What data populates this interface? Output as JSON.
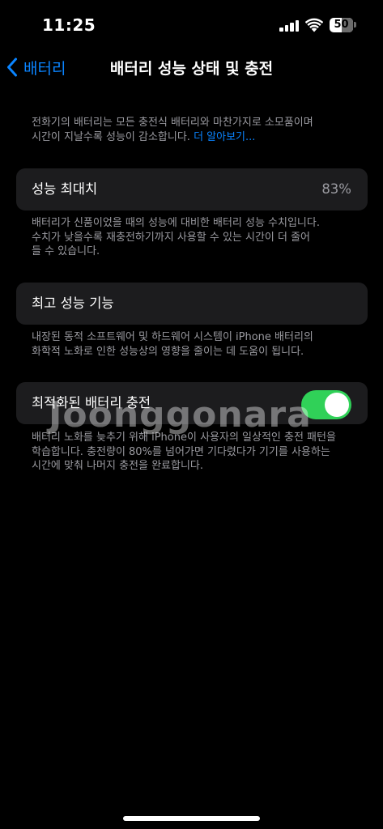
{
  "status_bar": {
    "time": "11:25",
    "battery_level": "50",
    "battery_fraction": 0.5,
    "signal_bars": 4
  },
  "nav": {
    "back_label": "배터리",
    "title": "배터리 성능 상태 및 충전"
  },
  "intro": {
    "line1": "전화기의 배터리는 모든 충전식 배터리와 마찬가지로 소모품이며",
    "line2": "시간이 지날수록 성능이 감소합니다.",
    "link": "더 알아보기..."
  },
  "max_capacity": {
    "label": "성능 최대치",
    "value": "83%",
    "desc_lines": [
      "배터리가 신품이었을 때의 성능에 대비한 배터리 성능 수치입니다.",
      "수치가 낮을수록 재충전하기까지 사용할 수 있는 시간이 더 줄어",
      "들 수 있습니다."
    ]
  },
  "peak_performance": {
    "label": "최고 성능 기능",
    "desc_lines": [
      "내장된 동적 소프트웨어 및 하드웨어 시스템이 iPhone 배터리의",
      "화학적 노화로 인한 성능상의 영향을 줄이는 데 도움이 됩니다."
    ]
  },
  "optimized_charging": {
    "label": "최적화된 배터리 충전",
    "enabled": true,
    "desc_lines": [
      "배터리 노화를 늦추기 위해 iPhone이 사용자의 일상적인 충전 패턴을",
      "학습합니다. 충전량이 80%를 넘어가면 기다렸다가 기기를 사용하는",
      "시간에 맞춰 나머지 충전을 완료합니다."
    ]
  },
  "watermark": {
    "text": "Joonggonara"
  },
  "colors": {
    "background": "#000000",
    "cell": "#1c1c1e",
    "accent_blue": "#0a84ff",
    "toggle_on": "#30d158",
    "secondary_text": "#9a9aa0"
  },
  "icons": {
    "back": "chevron-left-icon",
    "signal": "cellular-signal-icon",
    "wifi": "wifi-icon",
    "battery": "battery-icon"
  }
}
